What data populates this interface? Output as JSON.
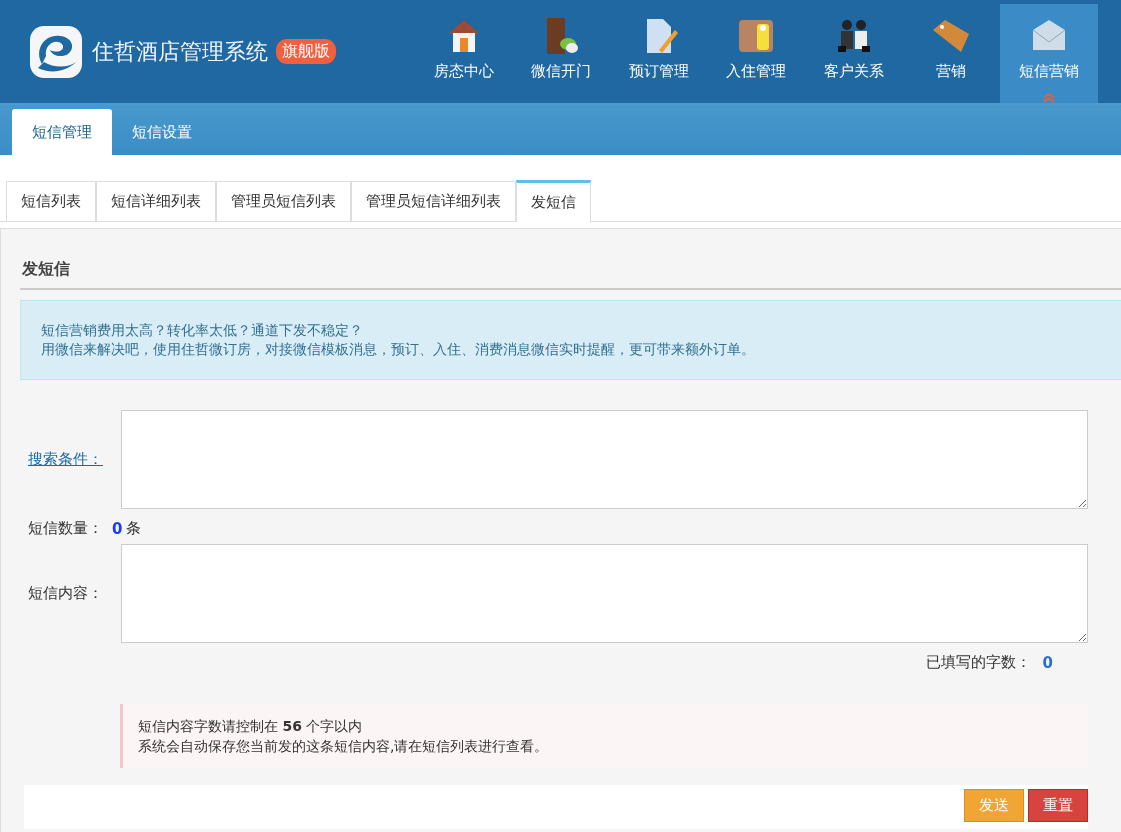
{
  "header": {
    "title": "住哲酒店管理系统",
    "badge": "旗舰版"
  },
  "nav": [
    {
      "label": "房态中心",
      "kind": "house",
      "selected": false
    },
    {
      "label": "微信开门",
      "kind": "door",
      "selected": false
    },
    {
      "label": "预订管理",
      "kind": "document",
      "selected": false
    },
    {
      "label": "入住管理",
      "kind": "checkin",
      "selected": false
    },
    {
      "label": "客户关系",
      "kind": "people",
      "selected": false
    },
    {
      "label": "营销",
      "kind": "tag",
      "selected": false
    },
    {
      "label": "短信营销",
      "kind": "envelope",
      "selected": true
    }
  ],
  "module_tabs": [
    {
      "label": "短信管理",
      "selected": true
    },
    {
      "label": "短信设置",
      "selected": false
    }
  ],
  "page_tabs": [
    {
      "label": "短信列表",
      "selected": false
    },
    {
      "label": "短信详细列表",
      "selected": false
    },
    {
      "label": "管理员短信列表",
      "selected": false
    },
    {
      "label": "管理员短信详细列表",
      "selected": false
    },
    {
      "label": "发短信",
      "selected": true
    }
  ],
  "section_title": "发短信",
  "info": [
    "短信营销费用太高？转化率太低？通道下发不稳定？",
    "用微信来解决吧，使用住哲微订房，对接微信模板消息，预订、入住、消费消息微信实时提醒，更可带来额外订单。"
  ],
  "form": {
    "search_label": "搜索条件：",
    "count_label": "短信数量：",
    "count_value": "0",
    "count_unit": "条",
    "content_label": "短信内容：",
    "typed_label": "已填写的字数：",
    "typed_value": "0"
  },
  "notes": [
    "短信内容字数请控制在 **56** 个字以内",
    "系统会自动保存您当前发的这条短信内容,请在短信列表进行查看。"
  ],
  "buttons": [
    {
      "label": "发送",
      "kind": "primary"
    },
    {
      "label": "重置",
      "kind": "danger"
    }
  ]
}
